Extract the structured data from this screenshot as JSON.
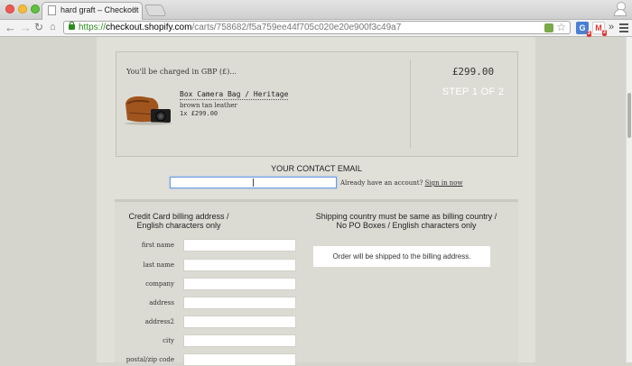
{
  "browser": {
    "tab_title": "hard graft – Checkout",
    "tab_close": "×",
    "url_scheme": "https://",
    "url_host": "checkout.shopify.com",
    "url_path": "/carts/758682/f5a759ee44f705c020e20e900f3c49a7",
    "gmail_badge": "3",
    "translate_badge": "3"
  },
  "summary": {
    "charge_note": "You'll be charged in GBP (£)...",
    "product_name": "Box Camera Bag / Heritage",
    "product_variant": "brown tan leather",
    "product_qty": "1x £299.00",
    "total": "£299.00",
    "step": "STEP 1 OF 2"
  },
  "contact": {
    "heading": "YOUR CONTACT EMAIL",
    "email_value": "",
    "account_prompt": "Already have an account?",
    "signin": "Sign in now"
  },
  "billing": {
    "heading": "Credit Card billing address / English characters only",
    "fields": [
      {
        "label": "first name",
        "value": ""
      },
      {
        "label": "last name",
        "value": ""
      },
      {
        "label": "company",
        "value": ""
      },
      {
        "label": "address",
        "value": ""
      },
      {
        "label": "address2",
        "value": ""
      },
      {
        "label": "city",
        "value": ""
      },
      {
        "label": "postal/zip code",
        "value": ""
      }
    ]
  },
  "shipping": {
    "heading": "Shipping country must be same as billing country / No PO Boxes / English characters only",
    "notice": "Order will be shipped to the billing address."
  }
}
